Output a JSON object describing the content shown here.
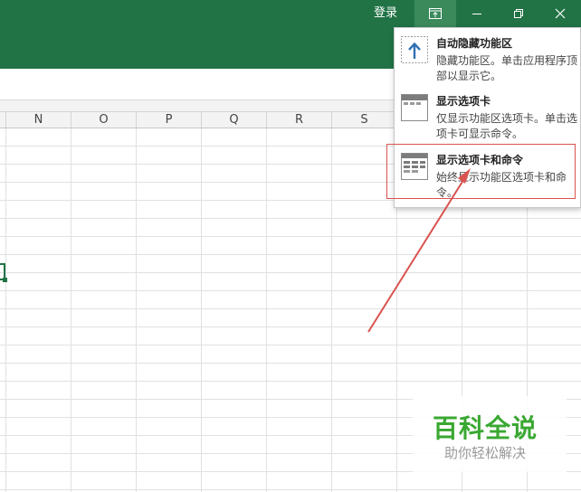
{
  "titlebar": {
    "signin_label": "登录",
    "buttons": [
      "ribbon-display-options",
      "minimize",
      "restore",
      "close"
    ]
  },
  "colors": {
    "excel_green": "#217346",
    "highlight_red": "#d9534f",
    "watermark_green": "#3aa832"
  },
  "columns": [
    "N",
    "O",
    "P",
    "Q",
    "R",
    "S"
  ],
  "ribbon_menu": {
    "items": [
      {
        "icon": "auto-hide-ribbon-icon",
        "title": "自动隐藏功能区",
        "description": "隐藏功能区。单击应用程序顶部以显示它。"
      },
      {
        "icon": "show-tabs-icon",
        "title": "显示选项卡",
        "description": "仅显示功能区选项卡。单击选项卡可显示命令。"
      },
      {
        "icon": "show-tabs-and-commands-icon",
        "title": "显示选项卡和命令",
        "description": "始终显示功能区选项卡和命令。",
        "highlighted": true
      }
    ]
  },
  "watermark": {
    "title": "百科全说",
    "subtitle": "助你轻松解决"
  }
}
